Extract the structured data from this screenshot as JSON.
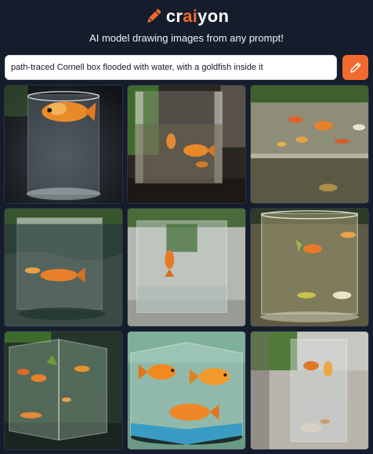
{
  "brand": {
    "name_prefix": "cr",
    "name_accent": "ai",
    "name_suffix": "yon",
    "logo_icon": "crayon-pencil-icon",
    "accent_color": "#f26a2f"
  },
  "tagline": "AI model drawing images from any prompt!",
  "prompt": {
    "value": "path-traced Cornell box flooded with water, with a goldfish inside it",
    "placeholder": ""
  },
  "draw_button": {
    "icon": "pencil-icon",
    "color": "#f26a2f"
  },
  "results": {
    "count": 9,
    "columns": 3
  }
}
